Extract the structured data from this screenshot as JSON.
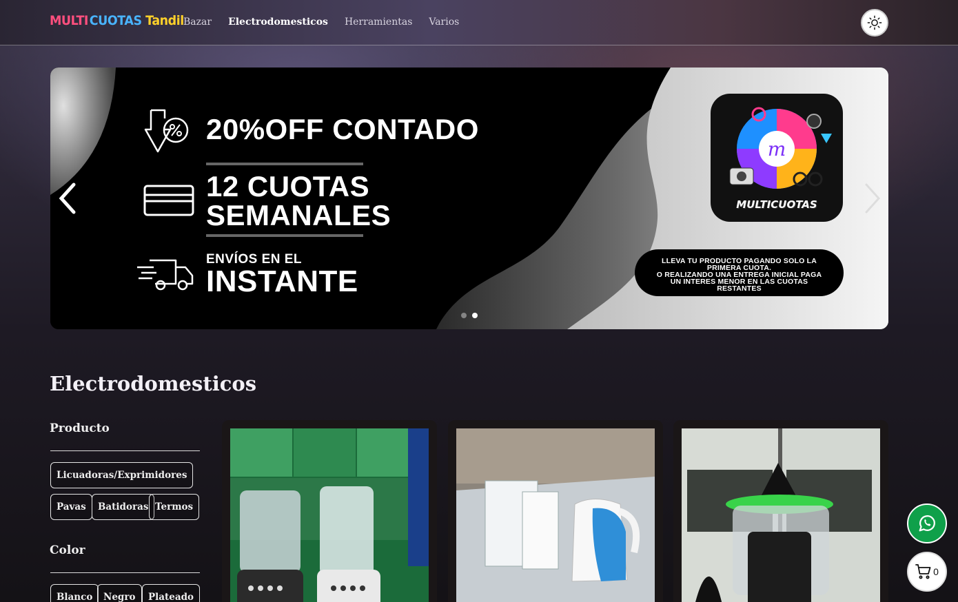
{
  "header": {
    "logo": {
      "part1": "MULTI",
      "part2": "CUOTAS",
      "part3": "Tandil"
    },
    "nav": [
      {
        "label": "Bazar",
        "active": false
      },
      {
        "label": "Electrodomesticos",
        "active": true
      },
      {
        "label": "Herramientas",
        "active": false
      },
      {
        "label": "Varios",
        "active": false
      }
    ],
    "theme_icon": "sun-icon"
  },
  "banner": {
    "line1": "20%OFF CONTADO",
    "line2a": "12 CUOTAS",
    "line2b": "SEMANALES",
    "line3a": "ENVÍOS EN EL",
    "line3b": "INSTANTE",
    "badge_label": "MULTICUOTAS",
    "pill_lines": [
      "LLEVA TU PRODUCTO PAGANDO SOLO LA",
      "PRIMERA CUOTA.",
      "O REALIZANDO UNA ENTREGA INICIAL PAGA",
      "UN INTERES MENOR EN LAS CUOTAS",
      "RESTANTES"
    ],
    "active_slide": 2,
    "slide_count": 2,
    "icons": [
      "discount-arrow-icon",
      "credit-card-icon",
      "delivery-truck-icon"
    ]
  },
  "section": {
    "title": "Electrodomesticos",
    "filters": [
      {
        "heading": "Producto",
        "options": [
          "Licuadoras/Exprimidores",
          "Pavas",
          "Batidoras",
          "Termos"
        ]
      },
      {
        "heading": "Color",
        "options": [
          "Blanco",
          "Negro",
          "Plateado"
        ]
      }
    ],
    "products": [
      {
        "image": "blenders-photo"
      },
      {
        "image": "electric-kettle-photo"
      },
      {
        "image": "juicer-photo"
      }
    ]
  },
  "floating": {
    "whatsapp_icon": "whatsapp-icon",
    "cart_icon": "cart-icon",
    "cart_count": "0"
  },
  "colors": {
    "accent_whatsapp": "#0fa04a",
    "logo_pink": "#ff4f7e",
    "logo_blue": "#49b4ff",
    "logo_yellow": "#ffd12a"
  }
}
